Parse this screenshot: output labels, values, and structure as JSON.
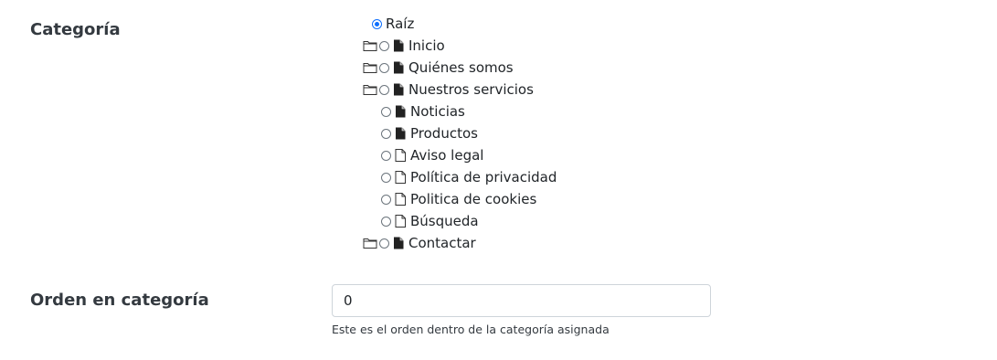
{
  "form": {
    "categoria_label": "Categoría",
    "orden_label": "Orden en categoría",
    "orden_value": "0",
    "orden_help": "Este es el orden dentro de la categoría asignada"
  },
  "tree": {
    "root": {
      "label": "Raíz",
      "selected": true
    },
    "items": [
      {
        "label": "Inicio",
        "has_folder": true,
        "doc_icon": "file-filled-icon",
        "level": 0
      },
      {
        "label": "Quiénes somos",
        "has_folder": true,
        "doc_icon": "file-filled-icon",
        "level": 0
      },
      {
        "label": "Nuestros servicios",
        "has_folder": true,
        "doc_icon": "file-filled-icon",
        "level": 0
      },
      {
        "label": "Noticias",
        "has_folder": false,
        "doc_icon": "file-filled-icon",
        "level": 1
      },
      {
        "label": "Productos",
        "has_folder": false,
        "doc_icon": "file-filled-icon",
        "level": 1
      },
      {
        "label": "Aviso legal",
        "has_folder": false,
        "doc_icon": "file-outline-icon",
        "level": 1
      },
      {
        "label": "Política de privacidad",
        "has_folder": false,
        "doc_icon": "file-outline-icon",
        "level": 1
      },
      {
        "label": "Politica de cookies",
        "has_folder": false,
        "doc_icon": "file-outline-icon",
        "level": 1
      },
      {
        "label": "Búsqueda",
        "has_folder": false,
        "doc_icon": "file-outline-icon",
        "level": 1
      },
      {
        "label": "Contactar",
        "has_folder": true,
        "doc_icon": "file-filled-icon",
        "level": 0
      }
    ]
  },
  "colors": {
    "accent": "#0d6efd",
    "text": "#212529",
    "border": "#ced4da"
  }
}
